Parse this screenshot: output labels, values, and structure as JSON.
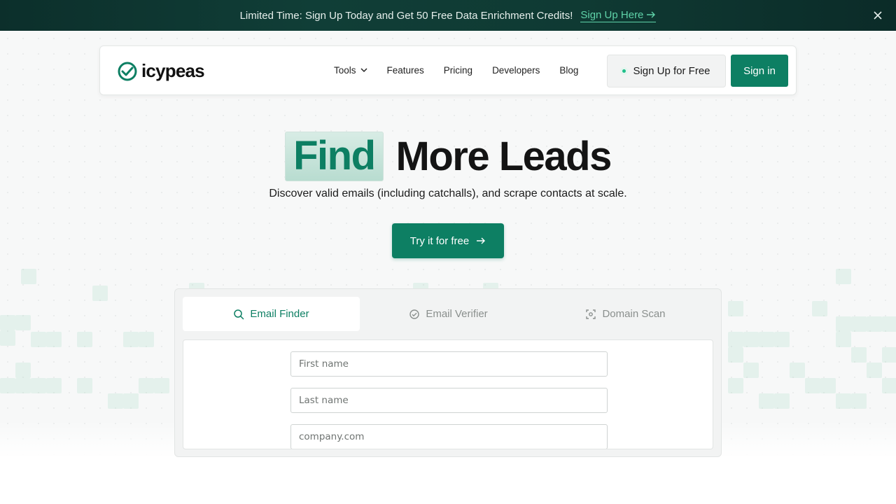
{
  "banner": {
    "text": "Limited Time: Sign Up Today and Get 50 Free Data Enrichment Credits!",
    "link_label": "Sign Up Here",
    "close_icon": "close-icon"
  },
  "navbar": {
    "logo_text": "icypeas",
    "items": [
      {
        "label": "Tools",
        "has_dropdown": true
      },
      {
        "label": "Features"
      },
      {
        "label": "Pricing"
      },
      {
        "label": "Developers"
      },
      {
        "label": "Blog"
      }
    ],
    "signup_label": "Sign Up for Free",
    "signin_label": "Sign in"
  },
  "hero": {
    "highlight": "Find",
    "title_rest": "More Leads",
    "subtitle": "Discover valid emails (including catchalls), and scrape contacts at scale.",
    "cta_label": "Try it for free"
  },
  "tool": {
    "tabs": [
      {
        "label": "Email Finder",
        "icon": "search-icon",
        "active": true
      },
      {
        "label": "Email Verifier",
        "icon": "check-circle-icon",
        "active": false
      },
      {
        "label": "Domain Scan",
        "icon": "scan-icon",
        "active": false
      }
    ],
    "fields": {
      "first_name_placeholder": "First name",
      "last_name_placeholder": "Last name",
      "domain_placeholder": "company.com"
    }
  },
  "colors": {
    "brand": "#0d7f63",
    "banner_bg": "#0f3a33",
    "banner_link": "#5fd3a9"
  }
}
